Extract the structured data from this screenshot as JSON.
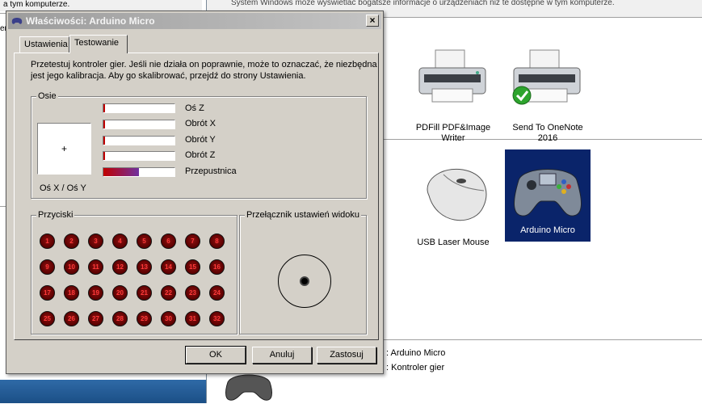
{
  "background": {
    "left_top_text": "a tym komputerze.",
    "left_partial_text": "ery",
    "top_banner_text": "System Windows może wyświetlać bogatsze informacje o urządzeniach niż te dostępne w tym komputerze.",
    "devices": [
      {
        "label": "PDFill PDF&Image Writer",
        "icon": "printer-icon"
      },
      {
        "label": "Send To OneNote 2016",
        "icon": "printer-default-icon"
      },
      {
        "label": "USB Laser Mouse",
        "icon": "mouse-icon"
      },
      {
        "label": "Arduino Micro",
        "icon": "gamepad-icon",
        "selected": true
      }
    ],
    "partial_label": "er",
    "details": {
      "row1": ": Arduino Micro",
      "row2": ": Kontroler gier"
    }
  },
  "dialog": {
    "title": "Właściwości: Arduino Micro",
    "close_label": "×",
    "tabs": [
      {
        "label": "Ustawienia",
        "active": false
      },
      {
        "label": "Testowanie",
        "active": true
      }
    ],
    "intro": "Przetestuj kontroler gier. Jeśli nie działa on poprawnie, może to oznaczać, że niezbędna jest jego kalibracja. Aby go skalibrować, przejdź do strony Ustawienia.",
    "axes_group": "Osie",
    "xy_label": "Oś X / Oś Y",
    "crosshair": "+",
    "axes": [
      {
        "label": "Oś Z",
        "level": 0.0
      },
      {
        "label": "Obrót X",
        "level": 0.0
      },
      {
        "label": "Obrót Y",
        "level": 0.0
      },
      {
        "label": "Obrót Z",
        "level": 0.0
      },
      {
        "label": "Przepustnica",
        "level": 0.5
      }
    ],
    "buttons_group": "Przyciski",
    "buttons": [
      "1",
      "2",
      "3",
      "4",
      "5",
      "6",
      "7",
      "8",
      "9",
      "10",
      "11",
      "12",
      "13",
      "14",
      "15",
      "16",
      "17",
      "18",
      "19",
      "20",
      "21",
      "22",
      "23",
      "24",
      "25",
      "26",
      "27",
      "28",
      "29",
      "30",
      "31",
      "32"
    ],
    "pov_group": "Przełącznik ustawień widoku",
    "ok_label": "OK",
    "cancel_label": "Anuluj",
    "apply_label": "Zastosuj"
  },
  "colors": {
    "dialog_face": "#d4d0c8",
    "selection": "#0a246a",
    "throttle_start": "#c00000",
    "throttle_end": "#7030a0",
    "button_off": "#5a0000"
  }
}
